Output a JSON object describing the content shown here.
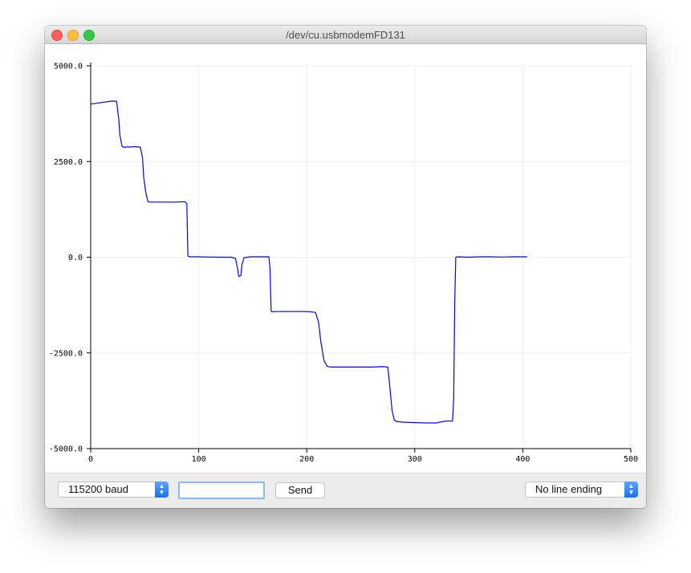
{
  "window": {
    "title": "/dev/cu.usbmodemFD131"
  },
  "controls": {
    "baud_value": "115200 baud",
    "send_label": "Send",
    "line_ending_value": "No line ending",
    "input_value": ""
  },
  "colors": {
    "series": "#0000ff",
    "grid": "#eeeeee",
    "accent": "#1a6ef3"
  },
  "icons": {
    "close": "close-traffic-light-icon",
    "minimize": "minimize-traffic-light-icon",
    "zoom": "zoom-traffic-light-icon",
    "popup_arrows": "up-down-chevron-icon"
  },
  "chart_data": {
    "type": "line",
    "title": "",
    "xlabel": "",
    "ylabel": "",
    "xlim": [
      0,
      500
    ],
    "ylim": [
      -5000,
      5000
    ],
    "xticks": [
      "0",
      "100",
      "200",
      "300",
      "400",
      "500"
    ],
    "yticks": [
      "5000.0",
      "2500.0",
      "0.0",
      "-2500.0",
      "-5000.0"
    ],
    "grid": true,
    "legend": "none",
    "series": [
      {
        "x": [
          0,
          5,
          10,
          15,
          20,
          24,
          26,
          27,
          29,
          31,
          33,
          37,
          42,
          46,
          48,
          49,
          51,
          53,
          55,
          60,
          70,
          80,
          87,
          89,
          90,
          92,
          100,
          110,
          120,
          130,
          134,
          136,
          137,
          139,
          140,
          142,
          148,
          155,
          162,
          165,
          166,
          167,
          168,
          170,
          180,
          190,
          200,
          208,
          211,
          213,
          216,
          219,
          222,
          230,
          240,
          250,
          260,
          270,
          275,
          277,
          279,
          281,
          283,
          286,
          290,
          300,
          310,
          320,
          325,
          329,
          335,
          336,
          337,
          338,
          340,
          350,
          360,
          370,
          380,
          390,
          400,
          404
        ],
        "y": [
          4000,
          4020,
          4040,
          4060,
          4080,
          4070,
          3600,
          3200,
          2900,
          2870,
          2880,
          2880,
          2890,
          2870,
          2600,
          2100,
          1700,
          1450,
          1440,
          1440,
          1440,
          1440,
          1450,
          1400,
          30,
          10,
          10,
          5,
          0,
          0,
          -30,
          -300,
          -500,
          -480,
          -200,
          -10,
          10,
          10,
          10,
          10,
          -300,
          -1400,
          -1430,
          -1420,
          -1420,
          -1420,
          -1420,
          -1440,
          -1700,
          -2200,
          -2700,
          -2850,
          -2870,
          -2870,
          -2870,
          -2870,
          -2870,
          -2860,
          -2870,
          -3400,
          -4000,
          -4250,
          -4290,
          -4300,
          -4310,
          -4320,
          -4330,
          -4330,
          -4300,
          -4280,
          -4280,
          -3700,
          -1200,
          0,
          10,
          0,
          10,
          10,
          5,
          10,
          10,
          10
        ]
      }
    ]
  }
}
